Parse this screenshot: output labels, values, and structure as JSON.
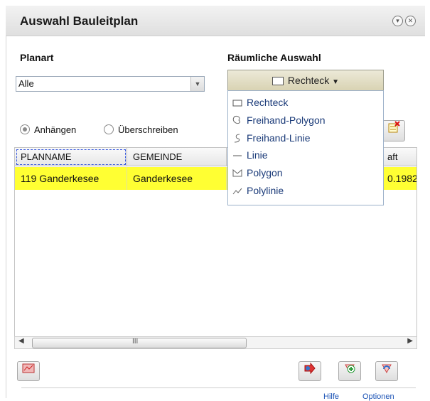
{
  "window": {
    "title": "Auswahl Bauleitplan"
  },
  "planart": {
    "label": "Planart",
    "value": "Alle"
  },
  "spatial": {
    "label": "Räumliche Auswahl",
    "button_label": "Rechteck",
    "menu": [
      {
        "label": "Rechteck",
        "icon": "rectangle-icon"
      },
      {
        "label": "Freihand-Polygon",
        "icon": "freehand-polygon-icon"
      },
      {
        "label": "Freihand-Linie",
        "icon": "freehand-line-icon"
      },
      {
        "label": "Linie",
        "icon": "line-icon"
      },
      {
        "label": "Polygon",
        "icon": "polygon-icon"
      },
      {
        "label": "Polylinie",
        "icon": "polyline-icon"
      }
    ]
  },
  "mode": {
    "append": "Anhängen",
    "overwrite": "Überschreiben",
    "selected": "append"
  },
  "table": {
    "columns": [
      "PLANNAME",
      "GEMEINDE",
      "aft"
    ],
    "rows": [
      [
        "119 Ganderkesee",
        "Ganderkesee",
        "0.1982"
      ]
    ]
  },
  "scrollbar": {
    "thumb_label": "III"
  },
  "footer": {
    "help": "Hilfe",
    "options": "Optionen"
  }
}
